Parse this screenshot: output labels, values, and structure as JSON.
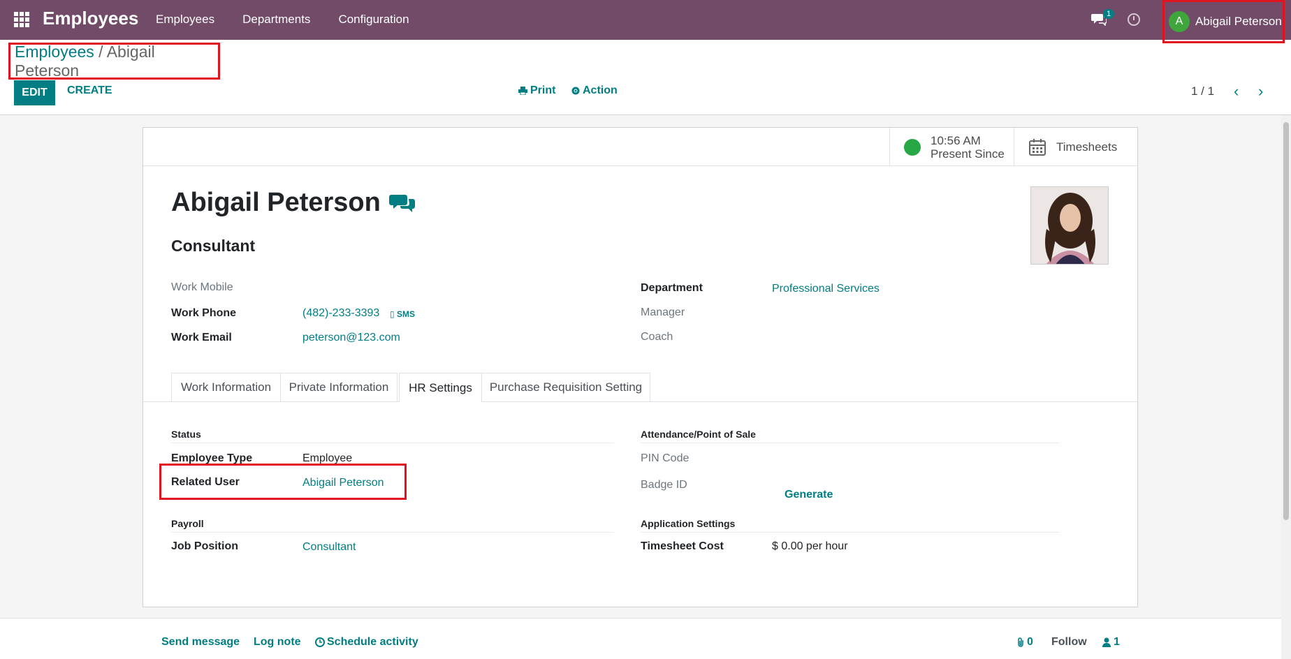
{
  "navbar": {
    "app_name": "Employees",
    "menu": [
      "Employees",
      "Departments",
      "Configuration"
    ],
    "messages_count": "1",
    "user_initial": "A",
    "user_name": "Abigail Peterson",
    "color": "#714b67"
  },
  "breadcrumb": {
    "parent": "Employees",
    "separator": " / ",
    "current": "Abigail Peterson"
  },
  "toolbar": {
    "edit_label": "EDIT",
    "create_label": "CREATE",
    "print_label": "Print",
    "action_label": "Action",
    "pager": "1 / 1"
  },
  "stat_buttons": {
    "attendance_time": "10:56 AM",
    "attendance_label": "Present Since",
    "timesheets_label": "Timesheets"
  },
  "employee": {
    "name": "Abigail Peterson",
    "job_title": "Consultant"
  },
  "contact": {
    "work_mobile_label": "Work Mobile",
    "work_phone_label": "Work Phone",
    "work_phone": "(482)-233-3393",
    "sms_label": "SMS",
    "work_email_label": "Work Email",
    "work_email": "peterson@123.com",
    "department_label": "Department",
    "department": "Professional Services",
    "manager_label": "Manager",
    "coach_label": "Coach"
  },
  "tabs": [
    "Work Information",
    "Private Information",
    "HR Settings",
    "Purchase Requisition Setting"
  ],
  "hr_settings": {
    "status_title": "Status",
    "employee_type_label": "Employee Type",
    "employee_type": "Employee",
    "related_user_label": "Related User",
    "related_user": "Abigail Peterson",
    "payroll_title": "Payroll",
    "job_position_label": "Job Position",
    "job_position": "Consultant",
    "attendance_title": "Attendance/Point of Sale",
    "pin_code_label": "PIN Code",
    "badge_id_label": "Badge ID",
    "generate_label": "Generate",
    "app_settings_title": "Application Settings",
    "timesheet_cost_label": "Timesheet Cost",
    "timesheet_cost": "$ 0.00 per hour"
  },
  "chatter": {
    "send_message": "Send message",
    "log_note": "Log note",
    "schedule_activity": "Schedule activity",
    "attachments_count": "0",
    "follow_label": "Follow",
    "followers_count": "1"
  }
}
